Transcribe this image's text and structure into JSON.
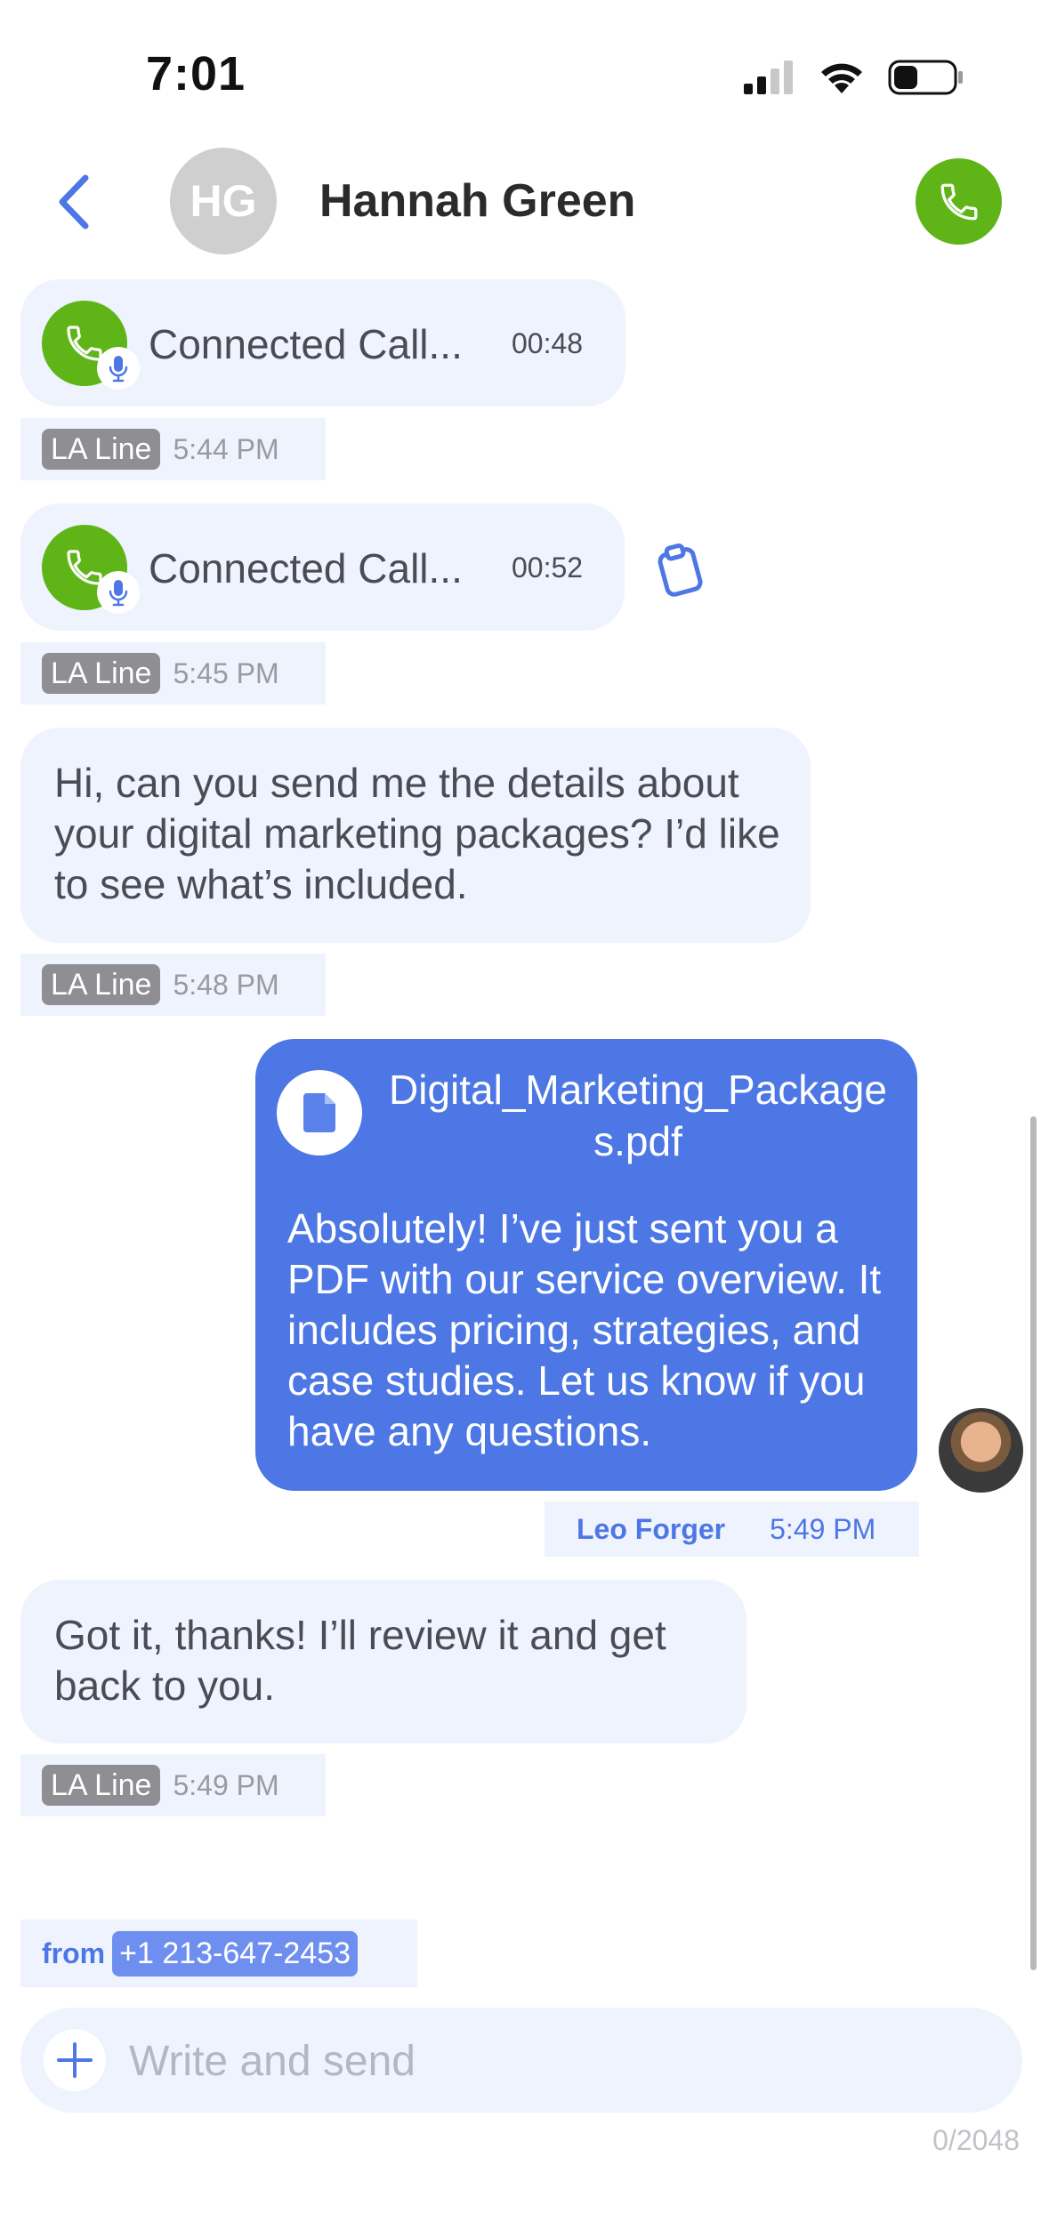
{
  "status_bar": {
    "time": "7:01"
  },
  "header": {
    "avatar_initials": "HG",
    "contact_name": "Hannah Green"
  },
  "messages": {
    "call1": {
      "label": "Connected Call...",
      "duration": "00:48",
      "line": "LA Line",
      "time": "5:44 PM"
    },
    "call2": {
      "label": "Connected Call...",
      "duration": "00:52",
      "line": "LA Line",
      "time": "5:45 PM"
    },
    "msg1": {
      "text": "Hi, can you send me the details about your digital marketing packages? I’d like to see what’s included.",
      "line": "LA Line",
      "time": "5:48 PM"
    },
    "msg2": {
      "file_name": "Digital_Marketing_Packages.pdf",
      "text": "Absolutely! I’ve just sent you a PDF with our service overview. It includes pricing, strategies, and case studies. Let us know if you have any questions.",
      "sender": "Leo Forger",
      "time": "5:49 PM"
    },
    "msg3": {
      "text": "Got it, thanks! I’ll review it and get back to you.",
      "line": "LA Line",
      "time": "5:49 PM"
    }
  },
  "composer": {
    "from_label": "from",
    "from_number": "+1 213-647-2453",
    "placeholder": "Write and send",
    "counter": "0/2048"
  },
  "colors": {
    "accent": "#4d77e5",
    "call_green": "#5fb517",
    "bubble_in": "#eef3fd"
  }
}
